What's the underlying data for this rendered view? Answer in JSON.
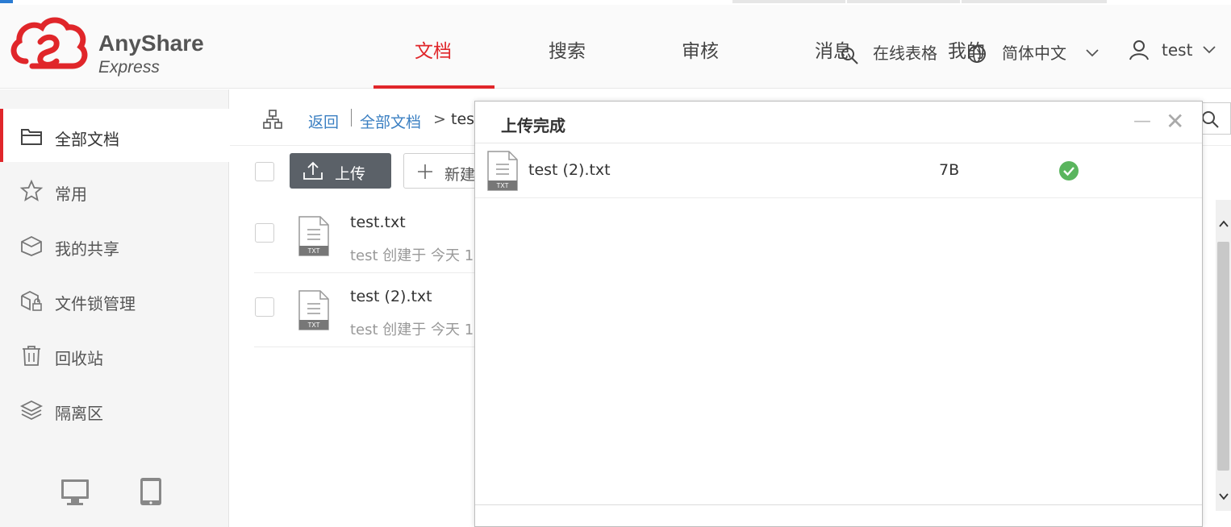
{
  "brand": {
    "name": "AnyShare",
    "edition": "Express",
    "accent": "#e0262a"
  },
  "nav": {
    "docs": "文档",
    "search": "搜索",
    "review": "审核",
    "messages": "消息",
    "online_sheets": "在线表格",
    "mine": "我的",
    "language": "简体中文",
    "user": "test"
  },
  "sidebar": {
    "items": [
      {
        "label": "全部文档",
        "icon": "folder-icon"
      },
      {
        "label": "常用",
        "icon": "star-icon"
      },
      {
        "label": "我的共享",
        "icon": "share-icon"
      },
      {
        "label": "文件锁管理",
        "icon": "lock-cube-icon"
      },
      {
        "label": "回收站",
        "icon": "trash-icon"
      },
      {
        "label": "隔离区",
        "icon": "layers-icon"
      }
    ]
  },
  "breadcrumb": {
    "back": "返回",
    "all_docs": "全部文档",
    "separator": ">",
    "current": "test"
  },
  "toolbar": {
    "upload": "上传",
    "new": "新建"
  },
  "files": [
    {
      "name": "test.txt",
      "meta": "test 创建于 今天 1"
    },
    {
      "name": "test (2).txt",
      "meta": "test 创建于 今天 1"
    }
  ],
  "upload_dialog": {
    "title": "上传完成",
    "minimize": "—",
    "close": "✕",
    "items": [
      {
        "name": "test (2).txt",
        "size": "7B",
        "status": "done"
      }
    ]
  },
  "file_badge": "TXT"
}
